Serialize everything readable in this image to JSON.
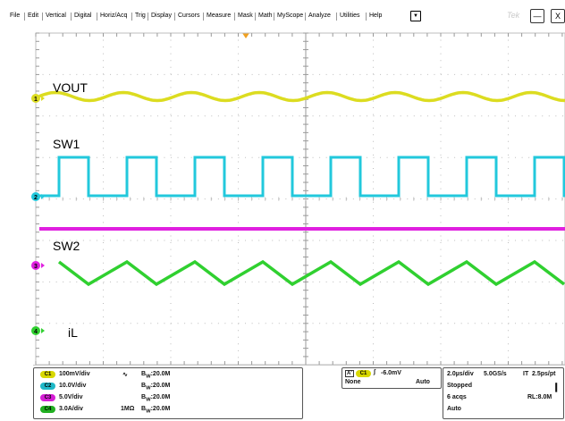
{
  "menu": {
    "items": [
      "File",
      "Edit",
      "Vertical",
      "Digital",
      "Horiz/Acq",
      "Trig",
      "Display",
      "Cursors",
      "Measure",
      "Mask",
      "Math",
      "MyScope",
      "Analyze",
      "Utilities",
      "Help"
    ],
    "dropdown_icon": "triangle-down",
    "brand": "Tek",
    "minimize_label": "—",
    "close_label": "X"
  },
  "labels": {
    "ch1": "VOUT",
    "ch2": "SW1",
    "ch3": "SW2",
    "ch4": "iL"
  },
  "channel_markers": {
    "ch1": "1",
    "ch2": "2",
    "ch3": "3",
    "ch4": "4"
  },
  "colors": {
    "ch1": "#dcdc20",
    "ch2": "#22c8dc",
    "ch3": "#e020e0",
    "ch4": "#30d030",
    "grid": "#bdbdbd",
    "trigger_marker": "#f0a020"
  },
  "channels": [
    {
      "chip": "C1",
      "scale": "100mV/div",
      "coupling_icon": "ac-coupling-icon",
      "impedance": "",
      "bw": "20.0M"
    },
    {
      "chip": "C2",
      "scale": "10.0V/div",
      "coupling_icon": "",
      "impedance": "",
      "bw": "20.0M"
    },
    {
      "chip": "C3",
      "scale": "5.0V/div",
      "coupling_icon": "",
      "impedance": "",
      "bw": "20.0M"
    },
    {
      "chip": "C4",
      "scale": "3.0A/div",
      "coupling_icon": "",
      "impedance": "1MΩ",
      "bw": "20.0M"
    }
  ],
  "bw_prefix": "B",
  "bw_sub": "W",
  "trigger": {
    "a_label": "A'",
    "source": "C1",
    "level": "-6.0mV",
    "type": "None",
    "mode": "Auto"
  },
  "acquisition": {
    "time_div": "2.0µs/div",
    "sample_rate": "5.0GS/s",
    "it_label": "IT",
    "it_value": "2.5ps/pt",
    "state": "Stopped",
    "acqs": "6 acqs",
    "record_length": "RL:8.0M",
    "mode": "Auto"
  }
}
